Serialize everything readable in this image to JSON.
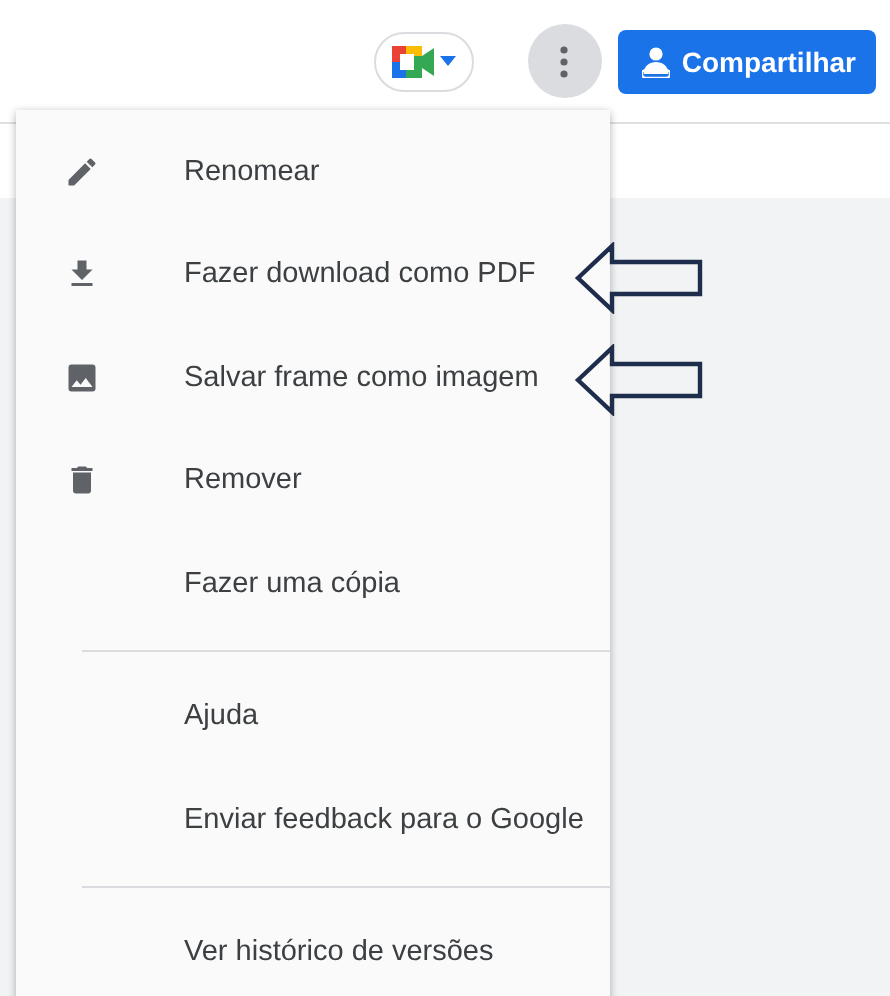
{
  "toolbar": {
    "meet_button": {
      "has_dropdown": true
    },
    "more_button": {
      "selected": true
    },
    "share_button": {
      "label": "Compartilhar"
    }
  },
  "menu": {
    "sections": [
      {
        "items": [
          {
            "label": "Renomear",
            "marked": false
          },
          {
            "label": "Fazer download como PDF",
            "marked": true
          },
          {
            "label": "Salvar frame como imagem",
            "marked": true
          },
          {
            "label": "Remover",
            "marked": false
          },
          {
            "label": "Fazer uma cópia",
            "marked": false
          }
        ]
      },
      {
        "items": [
          {
            "label": "Ajuda",
            "marked": false
          },
          {
            "label": "Enviar feedback para o Google",
            "marked": false
          }
        ]
      },
      {
        "items": [
          {
            "label": "Ver histórico de versões",
            "marked": false
          }
        ]
      }
    ]
  }
}
